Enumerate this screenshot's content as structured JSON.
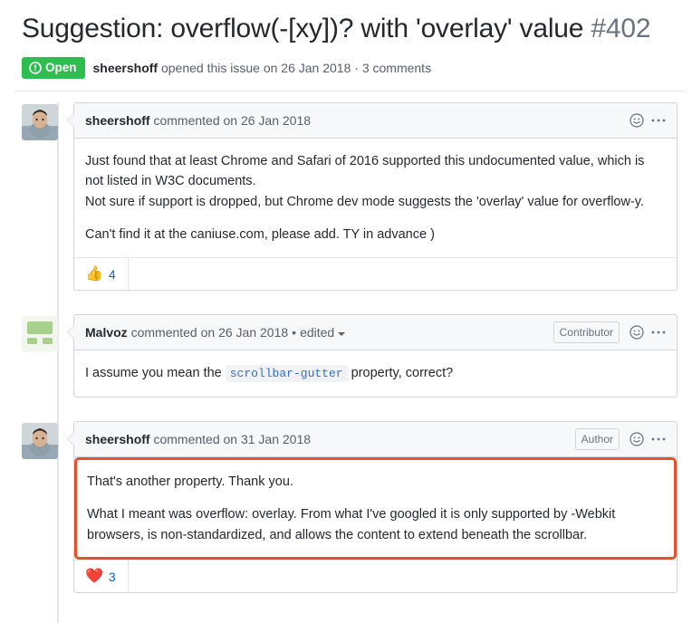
{
  "issue": {
    "title": "Suggestion: overflow(-[xy])? with 'overlay' value",
    "number": "#402",
    "state_label": "Open",
    "state_color": "#2cbe4e",
    "state_icon": "issue-opened-icon",
    "author": "sheershoff",
    "meta_opened": "opened this issue on 26 Jan 2018",
    "meta_separator": "·",
    "meta_comments": "3 comments"
  },
  "highlight_color": "#e8502a",
  "comments": [
    {
      "author": "sheershoff",
      "action": "commented on 26 Jan 2018",
      "edited": "",
      "role_badge": "",
      "avatar": "photo-avatar",
      "highlighted": false,
      "paragraphs": [
        {
          "lines": [
            "Just found that at least Chrome and Safari of 2016 supported this undocumented value, which is not listed in W3C documents.",
            "Not sure if support is dropped, but Chrome dev mode suggests the 'overlay' value for overflow-y."
          ]
        },
        {
          "lines": [
            "Can't find it at the caniuse.com, please add. TY in advance )"
          ]
        }
      ],
      "reaction": {
        "emoji": "👍",
        "name": "thumbs-up-emoji",
        "count": "4"
      }
    },
    {
      "author": "Malvoz",
      "action": "commented on 26 Jan 2018",
      "edited": "edited",
      "edited_separator": "•",
      "role_badge": "Contributor",
      "avatar": "identicon-avatar",
      "highlighted": false,
      "rich_paragraph": {
        "before": "I assume you mean the ",
        "code": "scrollbar-gutter",
        "after": " property, correct?"
      },
      "reaction": null
    },
    {
      "author": "sheershoff",
      "action": "commented on 31 Jan 2018",
      "edited": "",
      "role_badge": "Author",
      "avatar": "photo-avatar",
      "highlighted": true,
      "paragraphs": [
        {
          "lines": [
            "That's another property. Thank you."
          ]
        },
        {
          "lines": [
            "What I meant was overflow: overlay. From what I've googled it is only supported by -Webkit browsers, is non-standardized, and allows the content to extend beneath the scrollbar."
          ]
        }
      ],
      "reaction": {
        "emoji": "❤️",
        "name": "heart-emoji",
        "count": "3"
      }
    }
  ]
}
